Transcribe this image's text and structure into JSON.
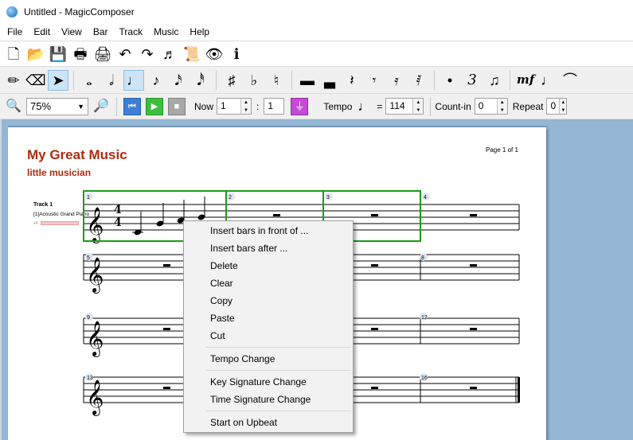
{
  "window": {
    "title": "Untitled - MagicComposer"
  },
  "menubar": [
    "File",
    "Edit",
    "View",
    "Bar",
    "Track",
    "Music",
    "Help"
  ],
  "toolbar_file": [
    {
      "name": "new-document-icon",
      "glyph": "🗋"
    },
    {
      "name": "open-folder-icon",
      "glyph": "📂"
    },
    {
      "name": "save-icon",
      "glyph": "💾"
    },
    {
      "name": "print-icon",
      "glyph": "🖶"
    },
    {
      "name": "print-preview-icon",
      "glyph": "🖨"
    },
    {
      "name": "undo-icon",
      "glyph": "↶"
    },
    {
      "name": "redo-icon",
      "glyph": "↷"
    },
    {
      "name": "music-library-icon",
      "glyph": "♬"
    },
    {
      "name": "score-setup-icon",
      "glyph": "📜"
    },
    {
      "name": "view-eye-icon",
      "glyph": "👁"
    },
    {
      "name": "info-icon",
      "glyph": "ℹ"
    }
  ],
  "toolbar_notes": [
    {
      "name": "pencil-icon",
      "glyph": "✏"
    },
    {
      "name": "eraser-icon",
      "glyph": "⌫"
    },
    {
      "name": "pointer-icon",
      "glyph": "➤",
      "active": true
    },
    {
      "sep": true
    },
    {
      "name": "whole-note-icon",
      "glyph": "𝅝"
    },
    {
      "name": "half-note-icon",
      "glyph": "𝅗𝅥"
    },
    {
      "name": "quarter-note-icon",
      "glyph": "♩",
      "active": true
    },
    {
      "name": "eighth-note-icon",
      "glyph": "♪"
    },
    {
      "name": "sixteenth-note-icon",
      "glyph": "𝅘𝅥𝅯"
    },
    {
      "name": "thirty-second-note-icon",
      "glyph": "𝅘𝅥𝅰"
    },
    {
      "sep": true
    },
    {
      "name": "sharp-icon",
      "glyph": "♯"
    },
    {
      "name": "flat-icon",
      "glyph": "♭"
    },
    {
      "name": "natural-icon",
      "glyph": "♮"
    },
    {
      "sep": true
    },
    {
      "name": "whole-rest-icon",
      "glyph": "▬"
    },
    {
      "name": "half-rest-icon",
      "glyph": "▃"
    },
    {
      "name": "quarter-rest-icon",
      "glyph": "𝄽"
    },
    {
      "name": "eighth-rest-icon",
      "glyph": "𝄾"
    },
    {
      "name": "sixteenth-rest-icon",
      "glyph": "𝄿"
    },
    {
      "name": "thirty-second-rest-icon",
      "glyph": "𝅀"
    },
    {
      "sep": true
    },
    {
      "name": "dot-icon",
      "glyph": "•"
    },
    {
      "name": "triplet-icon",
      "glyph": "3"
    },
    {
      "name": "tie-notes-icon",
      "glyph": "♫"
    },
    {
      "sep": true
    },
    {
      "name": "dynamics-mf-icon",
      "glyph": "mf"
    },
    {
      "name": "accent-note-icon",
      "glyph": "♩"
    },
    {
      "name": "slur-icon",
      "glyph": "⌒"
    }
  ],
  "transport": {
    "zoom": "75%",
    "now_label": "Now",
    "now_bar": "1",
    "now_beat": "1",
    "tempo_label": "Tempo",
    "tempo_equals": "=",
    "tempo_value": "114",
    "countin_label": "Count-in",
    "countin_value": "0",
    "repeat_label": "Repeat",
    "repeat_value": "0"
  },
  "score": {
    "title": "My Great Music",
    "subtitle": "little musician",
    "page_label": "Page 1 of 1",
    "track_name": "Track 1",
    "track_instrument": "[1]Acoustic Grand Piano",
    "track_volume_label": "+6",
    "bar_numbers": [
      "1",
      "2",
      "3",
      "4",
      "5",
      "8",
      "9",
      "12",
      "13",
      "16"
    ],
    "time_signature": [
      "4",
      "4"
    ],
    "selection_color": "#1a9c1a",
    "title_color": "#b02a0c"
  },
  "context_menu": {
    "items": [
      {
        "label": "Insert bars in front of ...",
        "name": "menu-insert-bars-before"
      },
      {
        "label": "Insert bars after ...",
        "name": "menu-insert-bars-after"
      },
      {
        "label": "Delete",
        "name": "menu-delete"
      },
      {
        "label": "Clear",
        "name": "menu-clear"
      },
      {
        "label": "Copy",
        "name": "menu-copy"
      },
      {
        "label": "Paste",
        "name": "menu-paste"
      },
      {
        "label": "Cut",
        "name": "menu-cut"
      },
      {
        "sep": true
      },
      {
        "label": "Tempo Change",
        "name": "menu-tempo-change"
      },
      {
        "sep": true
      },
      {
        "label": "Key Signature Change",
        "name": "menu-key-signature-change"
      },
      {
        "label": "Time Signature Change",
        "name": "menu-time-signature-change"
      },
      {
        "sep": true
      },
      {
        "label": "Start on Upbeat",
        "name": "menu-start-on-upbeat"
      }
    ]
  }
}
